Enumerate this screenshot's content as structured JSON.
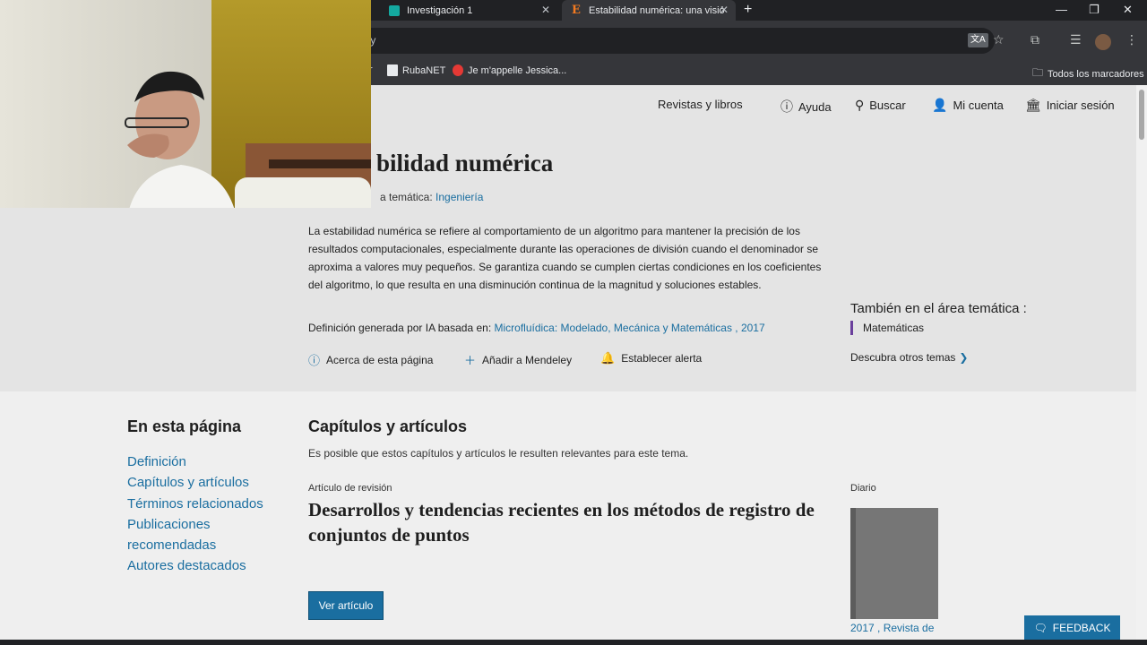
{
  "browser": {
    "tabs": [
      {
        "title": "Investigación 1",
        "favicon": "classroom-icon"
      },
      {
        "title": "Estabilidad numérica: una visió",
        "favicon": "elsevier-icon",
        "active": true
      }
    ],
    "address_partial": "ty",
    "bookmarks": [
      {
        "label": "r"
      },
      {
        "label": "RubaNET"
      },
      {
        "label": "Je m'appelle Jessica..."
      }
    ],
    "all_bookmarks_label": "Todos los marcadores"
  },
  "header": {
    "nav_journals": "Revistas y libros",
    "nav_help": "Ayuda",
    "nav_search": "Buscar",
    "nav_account": "Mi cuenta",
    "nav_signin": "Iniciar sesión"
  },
  "topic": {
    "title_partial": "bilidad numérica",
    "area_prefix": "a temática:",
    "area_link": "Ingeniería",
    "definition": "La estabilidad numérica se refiere al comportamiento de un algoritmo para mantener la precisión de los resultados computacionales, especialmente durante las operaciones de división cuando el denominador se aproxima a valores muy pequeños. Se garantiza cuando se cumplen ciertas condiciones en los coeficientes del algoritmo, lo que resulta en una disminución continua de la magnitud y soluciones estables.",
    "generated_prefix": "Definición generada por IA basada en:",
    "generated_source": "Microfluídica: Modelado, Mecánica y Matemáticas , 2017",
    "actions": {
      "about": "Acerca de esta página",
      "mendeley": "Añadir a Mendeley",
      "alert": "Establecer alerta"
    },
    "also_in_title": "También en el área temática :",
    "also_in_item": "Matemáticas",
    "discover": "Descubra otros temas"
  },
  "toc": {
    "title": "En esta página",
    "items": [
      "Definición",
      "Capítulos y artículos",
      "Términos relacionados",
      "Publicaciones recomendadas",
      "Autores destacados"
    ]
  },
  "chapters": {
    "title": "Capítulos y artículos",
    "subtitle": "Es posible que estos capítulos y artículos le resulten relevantes para este tema.",
    "article": {
      "type": "Artículo de revisión",
      "title": "Desarrollos y tendencias recientes en los métodos de registro de conjuntos de puntos",
      "button": "Ver artículo"
    },
    "journal": {
      "label": "Diario",
      "caption": "2017 , Revista de"
    }
  },
  "feedback": "FEEDBACK",
  "colors": {
    "accent": "#1a6ea0",
    "purple": "#6a3f9c",
    "chrome_dark": "#202124"
  }
}
